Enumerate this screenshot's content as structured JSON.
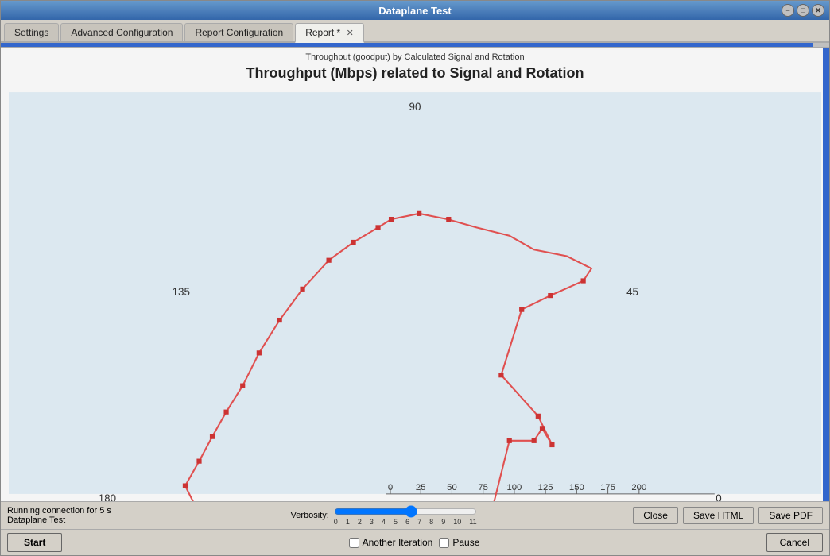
{
  "window": {
    "title": "Dataplane Test",
    "controls": [
      "minimize",
      "maximize",
      "close"
    ]
  },
  "tabs": [
    {
      "id": "settings",
      "label": "Settings",
      "active": false,
      "closable": false
    },
    {
      "id": "advanced-config",
      "label": "Advanced Configuration",
      "active": false,
      "closable": false
    },
    {
      "id": "report-config",
      "label": "Report Configuration",
      "active": false,
      "closable": false
    },
    {
      "id": "report",
      "label": "Report *",
      "active": true,
      "closable": true
    }
  ],
  "chart": {
    "subtitle": "Throughput (goodput) by Calculated Signal and Rotation",
    "title": "Throughput (Mbps) related to Signal and Rotation",
    "axis_labels": {
      "top": "90",
      "right": "45",
      "bottom_right": "0",
      "left": "135",
      "bottom_left": "180"
    },
    "scale_labels": [
      "0",
      "25",
      "50",
      "75",
      "100",
      "125",
      "150",
      "175",
      "200"
    ]
  },
  "status": {
    "line1": "Running connection for 5 s",
    "line2": "Dataplane Test"
  },
  "verbosity": {
    "label": "Verbosity:",
    "ticks": [
      "0",
      "1",
      "2",
      "3",
      "4",
      "5",
      "6",
      "7",
      "8",
      "9",
      "10",
      "11"
    ],
    "value": 6
  },
  "buttons": {
    "close": "Close",
    "save_html": "Save HTML",
    "save_pdf": "Save PDF",
    "start": "Start",
    "cancel": "Cancel"
  },
  "checkboxes": {
    "another_iteration": "Another Iteration",
    "pause": "Pause"
  }
}
